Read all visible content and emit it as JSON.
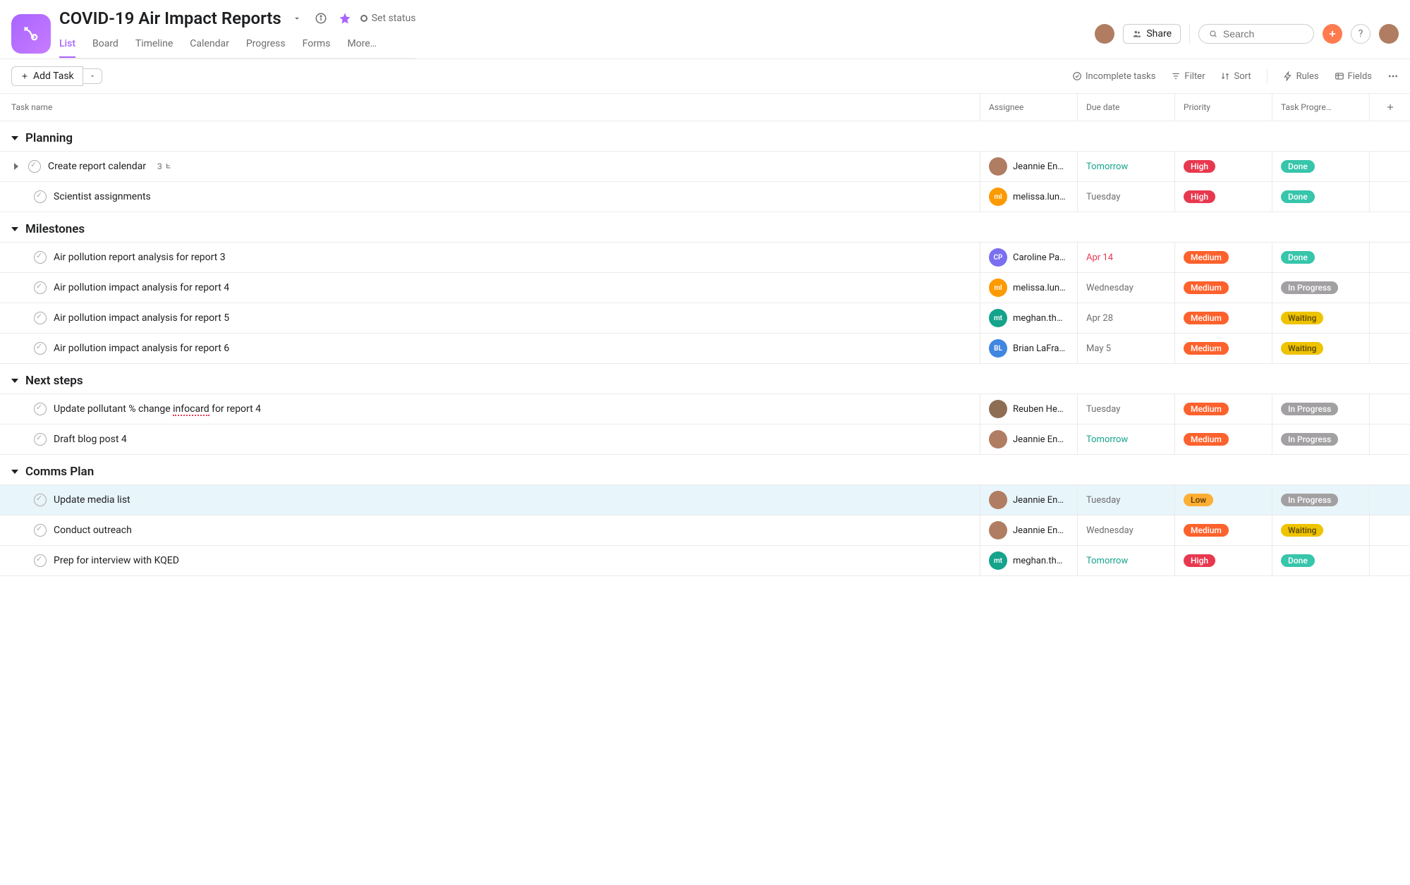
{
  "header": {
    "title": "COVID-19 Air Impact Reports",
    "set_status": "Set status",
    "share": "Share",
    "search_placeholder": "Search"
  },
  "tabs": [
    "List",
    "Board",
    "Timeline",
    "Calendar",
    "Progress",
    "Forms",
    "More…"
  ],
  "active_tab": "List",
  "toolbar": {
    "add_task": "Add Task",
    "incomplete": "Incomplete tasks",
    "filter": "Filter",
    "sort": "Sort",
    "rules": "Rules",
    "fields": "Fields"
  },
  "columns": {
    "name": "Task name",
    "assignee": "Assignee",
    "due": "Due date",
    "priority": "Priority",
    "progress": "Task Progre…"
  },
  "avatars": {
    "jeannie": {
      "bg": "#b07d62",
      "initials": ""
    },
    "melissa": {
      "bg": "#fd9a00",
      "initials": "ml"
    },
    "caroline": {
      "bg": "#7a6ff0",
      "initials": "CP"
    },
    "meghan": {
      "bg": "#14a38b",
      "initials": "mt"
    },
    "brian": {
      "bg": "#4186e0",
      "initials": "BL"
    },
    "reuben": {
      "bg": "#8e6e53",
      "initials": ""
    },
    "topuser": {
      "bg": "#b07d62",
      "initials": ""
    }
  },
  "sections": [
    {
      "name": "Planning",
      "tasks": [
        {
          "title": "Create report calendar",
          "subtasks": "3",
          "assignee": "Jeannie En…",
          "avatar": "jeannie",
          "due": "Tomorrow",
          "due_style": "teal",
          "priority": "High",
          "progress": "Done",
          "expandable": true
        },
        {
          "title": "Scientist assignments",
          "assignee": "melissa.lun…",
          "avatar": "melissa",
          "due": "Tuesday",
          "due_style": "gray",
          "priority": "High",
          "progress": "Done"
        }
      ]
    },
    {
      "name": "Milestones",
      "tasks": [
        {
          "title": "Air pollution report analysis for report 3",
          "assignee": "Caroline Pa…",
          "avatar": "caroline",
          "due": "Apr 14",
          "due_style": "red",
          "priority": "Medium",
          "progress": "Done"
        },
        {
          "title": "Air pollution impact analysis for report 4",
          "assignee": "melissa.lun…",
          "avatar": "melissa",
          "due": "Wednesday",
          "due_style": "gray",
          "priority": "Medium",
          "progress": "In Progress"
        },
        {
          "title": "Air pollution impact analysis for report 5",
          "assignee": "meghan.th…",
          "avatar": "meghan",
          "due": "Apr 28",
          "due_style": "gray",
          "priority": "Medium",
          "progress": "Waiting"
        },
        {
          "title": "Air pollution impact analysis for report 6",
          "assignee": "Brian LaFra…",
          "avatar": "brian",
          "due": "May 5",
          "due_style": "gray",
          "priority": "Medium",
          "progress": "Waiting"
        }
      ]
    },
    {
      "name": "Next steps",
      "tasks": [
        {
          "title_pre": "Update pollutant % change ",
          "title_mid": "infocard",
          "title_post": " for report 4",
          "assignee": "Reuben He…",
          "avatar": "reuben",
          "due": "Tuesday",
          "due_style": "gray",
          "priority": "Medium",
          "progress": "In Progress"
        },
        {
          "title": "Draft blog post 4",
          "assignee": "Jeannie En…",
          "avatar": "jeannie",
          "due": "Tomorrow",
          "due_style": "teal",
          "priority": "Medium",
          "progress": "In Progress"
        }
      ]
    },
    {
      "name": "Comms Plan",
      "tasks": [
        {
          "title": "Update media list",
          "assignee": "Jeannie En…",
          "avatar": "jeannie",
          "due": "Tuesday",
          "due_style": "gray",
          "priority": "Low",
          "progress": "In Progress",
          "highlight": true
        },
        {
          "title": "Conduct outreach",
          "assignee": "Jeannie En…",
          "avatar": "jeannie",
          "due": "Wednesday",
          "due_style": "gray",
          "priority": "Medium",
          "progress": "Waiting"
        },
        {
          "title": "Prep for interview with KQED",
          "assignee": "meghan.th…",
          "avatar": "meghan",
          "due": "Tomorrow",
          "due_style": "teal",
          "priority": "High",
          "progress": "Done"
        }
      ]
    }
  ]
}
